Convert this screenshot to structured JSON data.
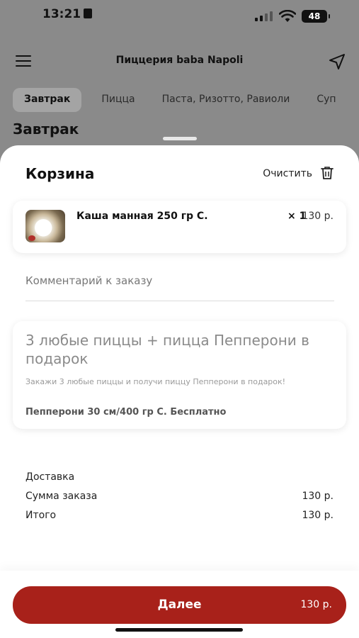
{
  "status_bar": {
    "time": "13:21",
    "battery": "48"
  },
  "header": {
    "title": "Пиццерия baba Napoli"
  },
  "tabs": [
    {
      "label": "Завтрак",
      "active": true
    },
    {
      "label": "Пицца",
      "active": false
    },
    {
      "label": "Паста, Ризотто, Равиоли",
      "active": false
    },
    {
      "label": "Суп",
      "active": false
    }
  ],
  "section": {
    "title": "Завтрак"
  },
  "cart": {
    "title": "Корзина",
    "clear_label": "Очистить",
    "items": [
      {
        "name": "Каша манная 250 гр С.",
        "qty": "× 1",
        "price": "130 р."
      }
    ],
    "comment_placeholder": "Комментарий к заказу"
  },
  "promo": {
    "title": "3 любые пиццы + пицца Пепперони в подарок",
    "description": "Закажи 3 любые пиццы и получи пиццу Пепперони в подарок!",
    "gift": "Пепперони 30 см/400 гр С. Бесплатно"
  },
  "summary": {
    "delivery_label": "Доставка",
    "subtotal_label": "Сумма заказа",
    "subtotal_value": "130 р.",
    "total_label": "Итого",
    "total_value": "130 р."
  },
  "checkout": {
    "label": "Далее",
    "price": "130 р.",
    "color": "#a8211a"
  }
}
